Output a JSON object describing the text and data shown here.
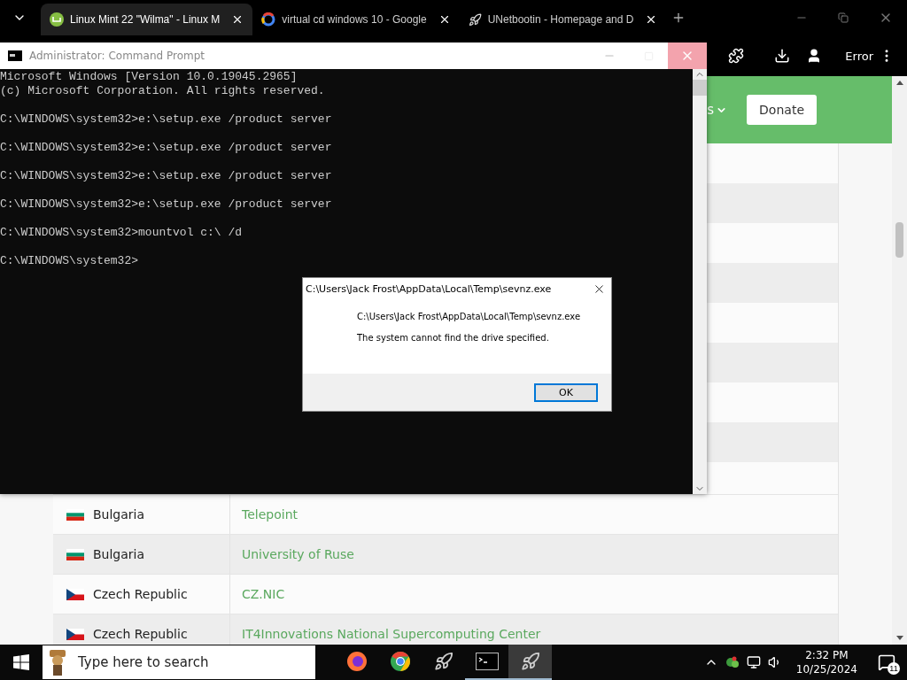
{
  "browser": {
    "tabs": [
      {
        "title": "Linux Mint 22 \"Wilma\" - Linux M",
        "kind": "mint",
        "selected": true
      },
      {
        "title": "virtual cd windows 10 - Google",
        "kind": "google",
        "selected": false
      },
      {
        "title": "UNetbootin - Homepage and D",
        "kind": "rocket",
        "selected": false
      }
    ],
    "profile_label": "Error",
    "header": {
      "nav_item": "s",
      "donate": "Donate"
    },
    "mirrors": [
      {
        "country": "Bulgaria",
        "kind": "bg",
        "mirror": "Telepoint"
      },
      {
        "country": "Bulgaria",
        "kind": "bg",
        "mirror": "University of Ruse"
      },
      {
        "country": "Czech Republic",
        "kind": "cz",
        "mirror": "CZ.NIC"
      },
      {
        "country": "Czech Republic",
        "kind": "cz",
        "mirror": "IT4Innovations National Supercomputing Center"
      }
    ]
  },
  "console": {
    "title": "Administrator: Command Prompt",
    "blocks": [
      [
        "Microsoft Windows [Version 10.0.19045.2965]",
        "(c) Microsoft Corporation. All rights reserved."
      ],
      [
        "C:\\WINDOWS\\system32>e:\\setup.exe /product server"
      ],
      [
        "C:\\WINDOWS\\system32>e:\\setup.exe /product server"
      ],
      [
        "C:\\WINDOWS\\system32>e:\\setup.exe /product server"
      ],
      [
        "C:\\WINDOWS\\system32>e:\\setup.exe /product server"
      ],
      [
        "C:\\WINDOWS\\system32>mountvol c:\\ /d"
      ],
      [
        "C:\\WINDOWS\\system32>"
      ]
    ]
  },
  "dialog": {
    "title": "C:\\Users\\Jack Frost\\AppData\\Local\\Temp\\sevnz.exe",
    "path": "C:\\Users\\Jack Frost\\AppData\\Local\\Temp\\sevnz.exe",
    "message": "The system cannot find the drive specified.",
    "button": "OK"
  },
  "taskbar": {
    "search_placeholder": "Type here to search",
    "apps": [
      {
        "kind": "firefox",
        "selected": false,
        "running": false
      },
      {
        "kind": "chrome",
        "selected": false,
        "running": false
      },
      {
        "kind": "rocket",
        "selected": false,
        "running": false
      },
      {
        "kind": "terminal",
        "selected": false,
        "running": true
      },
      {
        "kind": "rocket",
        "selected": true,
        "running": true
      }
    ],
    "time": "2:32 PM",
    "date": "10/25/2024",
    "notifications": "11"
  }
}
